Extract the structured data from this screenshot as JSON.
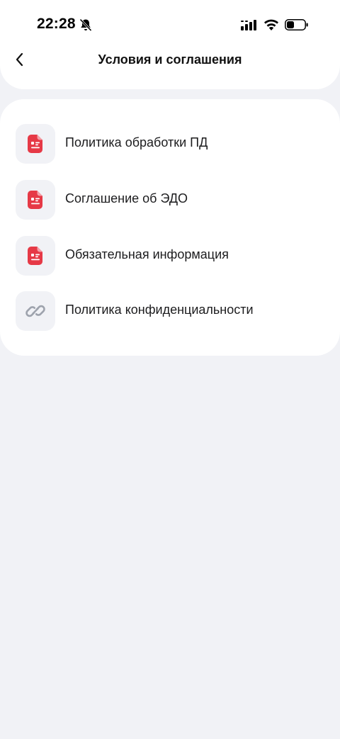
{
  "status_bar": {
    "time": "22:28",
    "icons": [
      "bell-slash-icon",
      "cellular-signal-icon",
      "wifi-icon",
      "battery-icon"
    ]
  },
  "header": {
    "back_icon": "chevron-left-icon",
    "title": "Условия и соглашения"
  },
  "colors": {
    "accent_red": "#e63946",
    "icon_gray": "#9ea3ad",
    "icon_bg": "#f1f2f6",
    "page_bg": "#f1f2f6"
  },
  "items": [
    {
      "label": "Политика обработки ПД",
      "icon": "document-icon"
    },
    {
      "label": "Соглашение об ЭДО",
      "icon": "document-icon"
    },
    {
      "label": "Обязательная информация",
      "icon": "document-icon"
    },
    {
      "label": "Политика конфиденциальности",
      "icon": "link-icon"
    }
  ]
}
